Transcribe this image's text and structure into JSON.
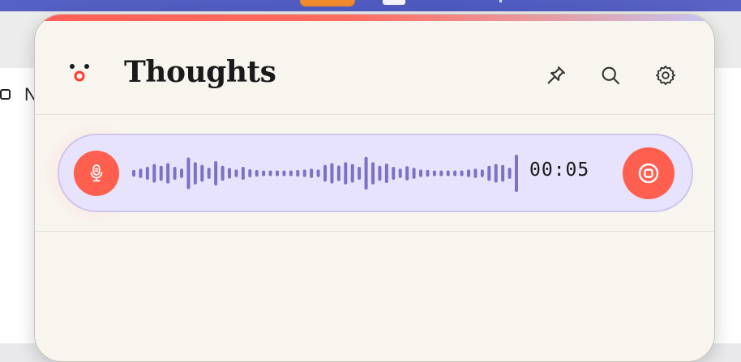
{
  "background": {
    "partial_letter": "N"
  },
  "header": {
    "title": "Thoughts",
    "buttons": [
      {
        "icon": "pin-icon"
      },
      {
        "icon": "search-icon"
      },
      {
        "icon": "gear-icon"
      }
    ]
  },
  "recorder": {
    "state": "recording",
    "timer": "00:05",
    "waveform_levels": [
      0.18,
      0.25,
      0.35,
      0.5,
      0.4,
      0.55,
      0.35,
      0.25,
      0.85,
      0.6,
      0.45,
      0.3,
      0.65,
      0.4,
      0.28,
      0.2,
      0.35,
      0.22,
      0.18,
      0.15,
      0.15,
      0.15,
      0.15,
      0.15,
      0.18,
      0.2,
      0.25,
      0.2,
      0.45,
      0.55,
      0.42,
      0.6,
      0.5,
      0.35,
      0.88,
      0.6,
      0.4,
      0.52,
      0.35,
      0.25,
      0.38,
      0.3,
      0.2,
      0.18,
      0.15,
      0.15,
      0.15,
      0.15,
      0.15,
      0.2,
      0.25,
      0.2,
      0.4,
      0.5,
      0.45,
      0.3,
      1.0
    ]
  },
  "colors": {
    "accent": "#ff5f4f",
    "waveform": "#7c72c4",
    "record_bar": "#e7e3fc",
    "panel": "#f8f5ef"
  }
}
